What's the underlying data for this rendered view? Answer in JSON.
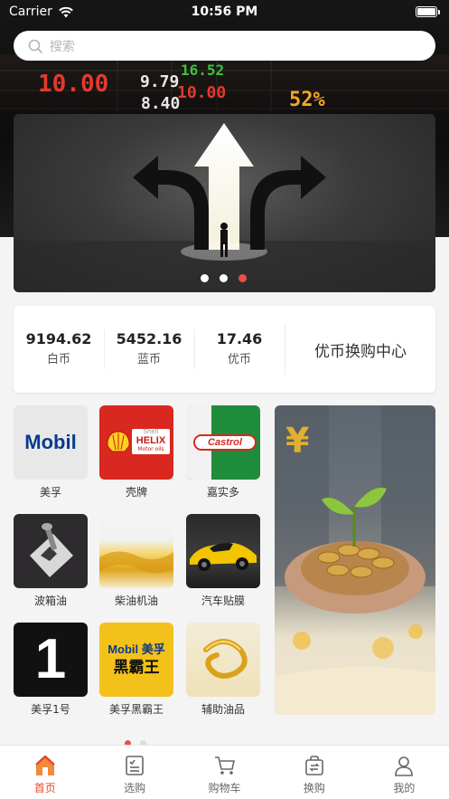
{
  "status_bar": {
    "carrier": "Carrier",
    "time": "10:56 PM"
  },
  "search": {
    "placeholder": "搜索"
  },
  "hero_tickers": [
    "10.00",
    "9.79",
    "10.00",
    "8.40",
    "16.52",
    "52%"
  ],
  "banner": {
    "slide_count": 3,
    "active_slide": 3
  },
  "balances": [
    {
      "value": "9194.62",
      "label": "白币"
    },
    {
      "value": "5452.16",
      "label": "蓝币"
    },
    {
      "value": "17.46",
      "label": "优币"
    }
  ],
  "exchange_center": "优币换购中心",
  "brands": [
    {
      "label": "美孚",
      "icon": "mobil-logo"
    },
    {
      "label": "壳牌",
      "icon": "shell-helix-logo"
    },
    {
      "label": "嘉实多",
      "icon": "castrol-logo"
    },
    {
      "label": "波箱油",
      "icon": "gear-shifter-image"
    },
    {
      "label": "柴油机油",
      "icon": "oil-splash-image"
    },
    {
      "label": "汽车贴膜",
      "icon": "sports-car-image"
    },
    {
      "label": "美孚1号",
      "icon": "mobil-1-logo"
    },
    {
      "label": "美孚黑霸王",
      "icon": "mobil-heibawang-logo"
    },
    {
      "label": "辅助油品",
      "icon": "oil-drop-image"
    }
  ],
  "brand_logo_text": {
    "mobil": "Mobil",
    "shell_small": "Shell",
    "helix": "HELIX",
    "motor_oils": "Motor oils",
    "castrol": "Castrol",
    "mobil1": "1",
    "mobil_cn": "Mobil 美孚",
    "heibawang": "黑霸王"
  },
  "grid_pages": {
    "count": 2,
    "active": 1
  },
  "tabs": [
    {
      "label": "首页",
      "icon": "home-icon",
      "active": true
    },
    {
      "label": "选购",
      "icon": "list-icon",
      "active": false
    },
    {
      "label": "购物车",
      "icon": "cart-icon",
      "active": false
    },
    {
      "label": "换购",
      "icon": "exchange-bag-icon",
      "active": false
    },
    {
      "label": "我的",
      "icon": "user-icon",
      "active": false
    }
  ],
  "colors": {
    "accent": "#e8452e",
    "active_dot": "#e94f4f"
  }
}
